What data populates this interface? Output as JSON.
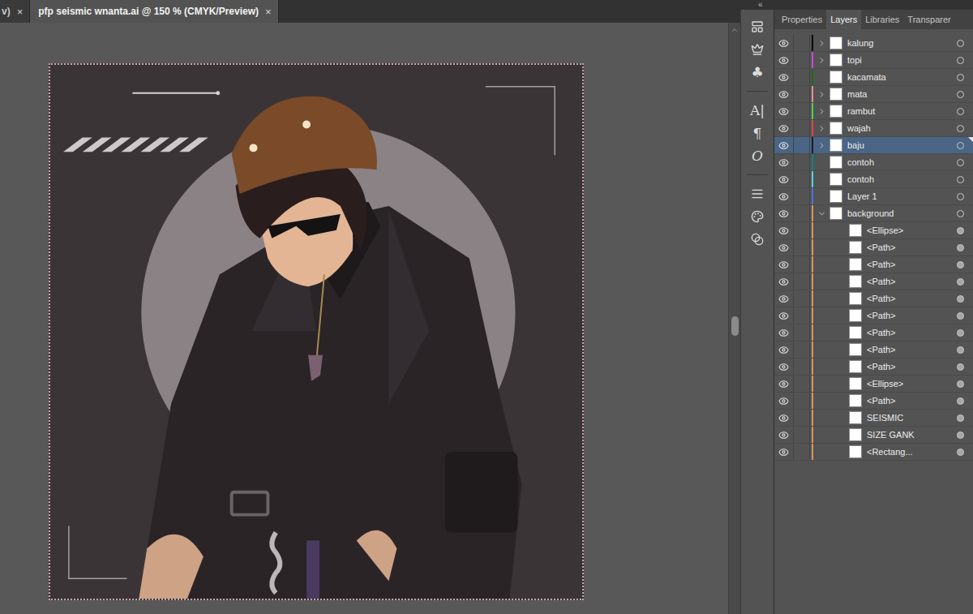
{
  "document_tabs": [
    {
      "label": "v)",
      "close": "×",
      "selected": false
    },
    {
      "label": "pfp seismic wnanta.ai @ 150 % (CMYK/Preview)",
      "close": "×",
      "selected": true
    }
  ],
  "panel_collapse": "«",
  "side_tools": [
    {
      "kind": "icon"
    },
    {
      "kind": "icon"
    },
    {
      "kind": "glyph",
      "text": "♣"
    },
    {
      "kind": "glyph",
      "text": "A|"
    },
    {
      "kind": "glyph",
      "text": "¶"
    },
    {
      "kind": "glyph",
      "text": "O"
    },
    {
      "kind": "icon"
    },
    {
      "kind": "icon"
    },
    {
      "kind": "icon"
    }
  ],
  "panel_tabs": [
    {
      "label": "Properties",
      "selected": false
    },
    {
      "label": "Layers",
      "selected": true
    },
    {
      "label": "Libraries",
      "selected": false
    },
    {
      "label": "Transparer",
      "selected": false
    }
  ],
  "layers": [
    {
      "name": "kalung",
      "kind": "layer",
      "color": "#000000",
      "visible": true,
      "expandable": true,
      "expanded": false,
      "selected": false
    },
    {
      "name": "topi",
      "kind": "layer",
      "color": "#c64fd0",
      "visible": true,
      "expandable": true,
      "expanded": false,
      "selected": false
    },
    {
      "name": "kacamata",
      "kind": "layer",
      "color": "#1d6a1d",
      "visible": true,
      "expandable": false,
      "expanded": false,
      "selected": false
    },
    {
      "name": "mata",
      "kind": "layer",
      "color": "#e88e9e",
      "visible": true,
      "expandable": true,
      "expanded": false,
      "selected": false
    },
    {
      "name": "rambut",
      "kind": "layer",
      "color": "#4fd44f",
      "visible": true,
      "expandable": true,
      "expanded": false,
      "selected": false
    },
    {
      "name": "wajah",
      "kind": "layer",
      "color": "#e04545",
      "visible": true,
      "expandable": true,
      "expanded": false,
      "selected": false
    },
    {
      "name": "baju",
      "kind": "layer",
      "color": "#1c1c2a",
      "visible": true,
      "expandable": true,
      "expanded": false,
      "selected": true
    },
    {
      "name": "contoh",
      "kind": "layer",
      "color": "#00897b",
      "visible": true,
      "expandable": false,
      "expanded": false,
      "selected": false
    },
    {
      "name": "contoh",
      "kind": "layer",
      "color": "#4fd8e2",
      "visible": true,
      "expandable": false,
      "expanded": false,
      "selected": false
    },
    {
      "name": "Layer 1",
      "kind": "layer",
      "color": "#4f6fe0",
      "visible": true,
      "expandable": false,
      "expanded": false,
      "selected": false
    },
    {
      "name": "background",
      "kind": "layer",
      "color": "#d8975a",
      "visible": true,
      "expandable": true,
      "expanded": true,
      "selected": false
    },
    {
      "name": "<Ellipse>",
      "kind": "item",
      "color": "#d8975a",
      "visible": true,
      "expandable": false,
      "expanded": false,
      "selected": false
    },
    {
      "name": "<Path>",
      "kind": "item",
      "color": "#d8975a",
      "visible": true,
      "expandable": false,
      "expanded": false,
      "selected": false
    },
    {
      "name": "<Path>",
      "kind": "item",
      "color": "#d8975a",
      "visible": true,
      "expandable": false,
      "expanded": false,
      "selected": false
    },
    {
      "name": "<Path>",
      "kind": "item",
      "color": "#d8975a",
      "visible": true,
      "expandable": false,
      "expanded": false,
      "selected": false
    },
    {
      "name": "<Path>",
      "kind": "item",
      "color": "#d8975a",
      "visible": true,
      "expandable": false,
      "expanded": false,
      "selected": false
    },
    {
      "name": "<Path>",
      "kind": "item",
      "color": "#d8975a",
      "visible": true,
      "expandable": false,
      "expanded": false,
      "selected": false
    },
    {
      "name": "<Path>",
      "kind": "item",
      "color": "#d8975a",
      "visible": true,
      "expandable": false,
      "expanded": false,
      "selected": false
    },
    {
      "name": "<Path>",
      "kind": "item",
      "color": "#d8975a",
      "visible": true,
      "expandable": false,
      "expanded": false,
      "selected": false
    },
    {
      "name": "<Path>",
      "kind": "item",
      "color": "#d8975a",
      "visible": true,
      "expandable": false,
      "expanded": false,
      "selected": false
    },
    {
      "name": "<Ellipse>",
      "kind": "item",
      "color": "#d8975a",
      "visible": true,
      "expandable": false,
      "expanded": false,
      "selected": false
    },
    {
      "name": "<Path>",
      "kind": "item",
      "color": "#d8975a",
      "visible": true,
      "expandable": false,
      "expanded": false,
      "selected": false
    },
    {
      "name": "SEISMIC",
      "kind": "item",
      "color": "#d8975a",
      "visible": true,
      "expandable": false,
      "expanded": false,
      "selected": false
    },
    {
      "name": "SIZE GANK",
      "kind": "item",
      "color": "#d8975a",
      "visible": true,
      "expandable": false,
      "expanded": false,
      "selected": false
    },
    {
      "name": "<Rectang...",
      "kind": "item",
      "color": "#d8975a",
      "visible": true,
      "expandable": false,
      "expanded": false,
      "selected": false
    }
  ]
}
